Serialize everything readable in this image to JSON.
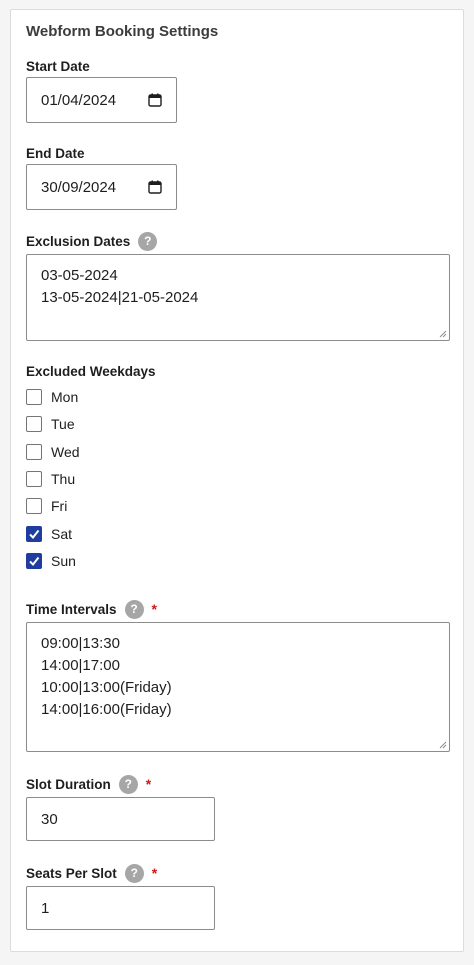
{
  "title": "Webform Booking Settings",
  "start_date": {
    "label": "Start Date",
    "value": "01/04/2024"
  },
  "end_date": {
    "label": "End Date",
    "value": "30/09/2024"
  },
  "exclusion_dates": {
    "label": "Exclusion Dates",
    "help": "?",
    "lines": [
      "03-05-2024",
      "13-05-2024|21-05-2024"
    ]
  },
  "excluded_weekdays": {
    "label": "Excluded Weekdays",
    "days": [
      {
        "label": "Mon",
        "checked": false
      },
      {
        "label": "Tue",
        "checked": false
      },
      {
        "label": "Wed",
        "checked": false
      },
      {
        "label": "Thu",
        "checked": false
      },
      {
        "label": "Fri",
        "checked": false
      },
      {
        "label": "Sat",
        "checked": true
      },
      {
        "label": "Sun",
        "checked": true
      }
    ]
  },
  "time_intervals": {
    "label": "Time Intervals",
    "help": "?",
    "required": "*",
    "lines": [
      "09:00|13:30",
      "14:00|17:00",
      "10:00|13:00(Friday)",
      "14:00|16:00(Friday)"
    ]
  },
  "slot_duration": {
    "label": "Slot Duration",
    "help": "?",
    "required": "*",
    "value": "30"
  },
  "seats_per_slot": {
    "label": "Seats Per Slot",
    "help": "?",
    "required": "*",
    "value": "1"
  },
  "colors": {
    "checkbox_checked": "#1e3d9e",
    "required": "#cc1818",
    "help_badge": "#a6a6a6"
  }
}
